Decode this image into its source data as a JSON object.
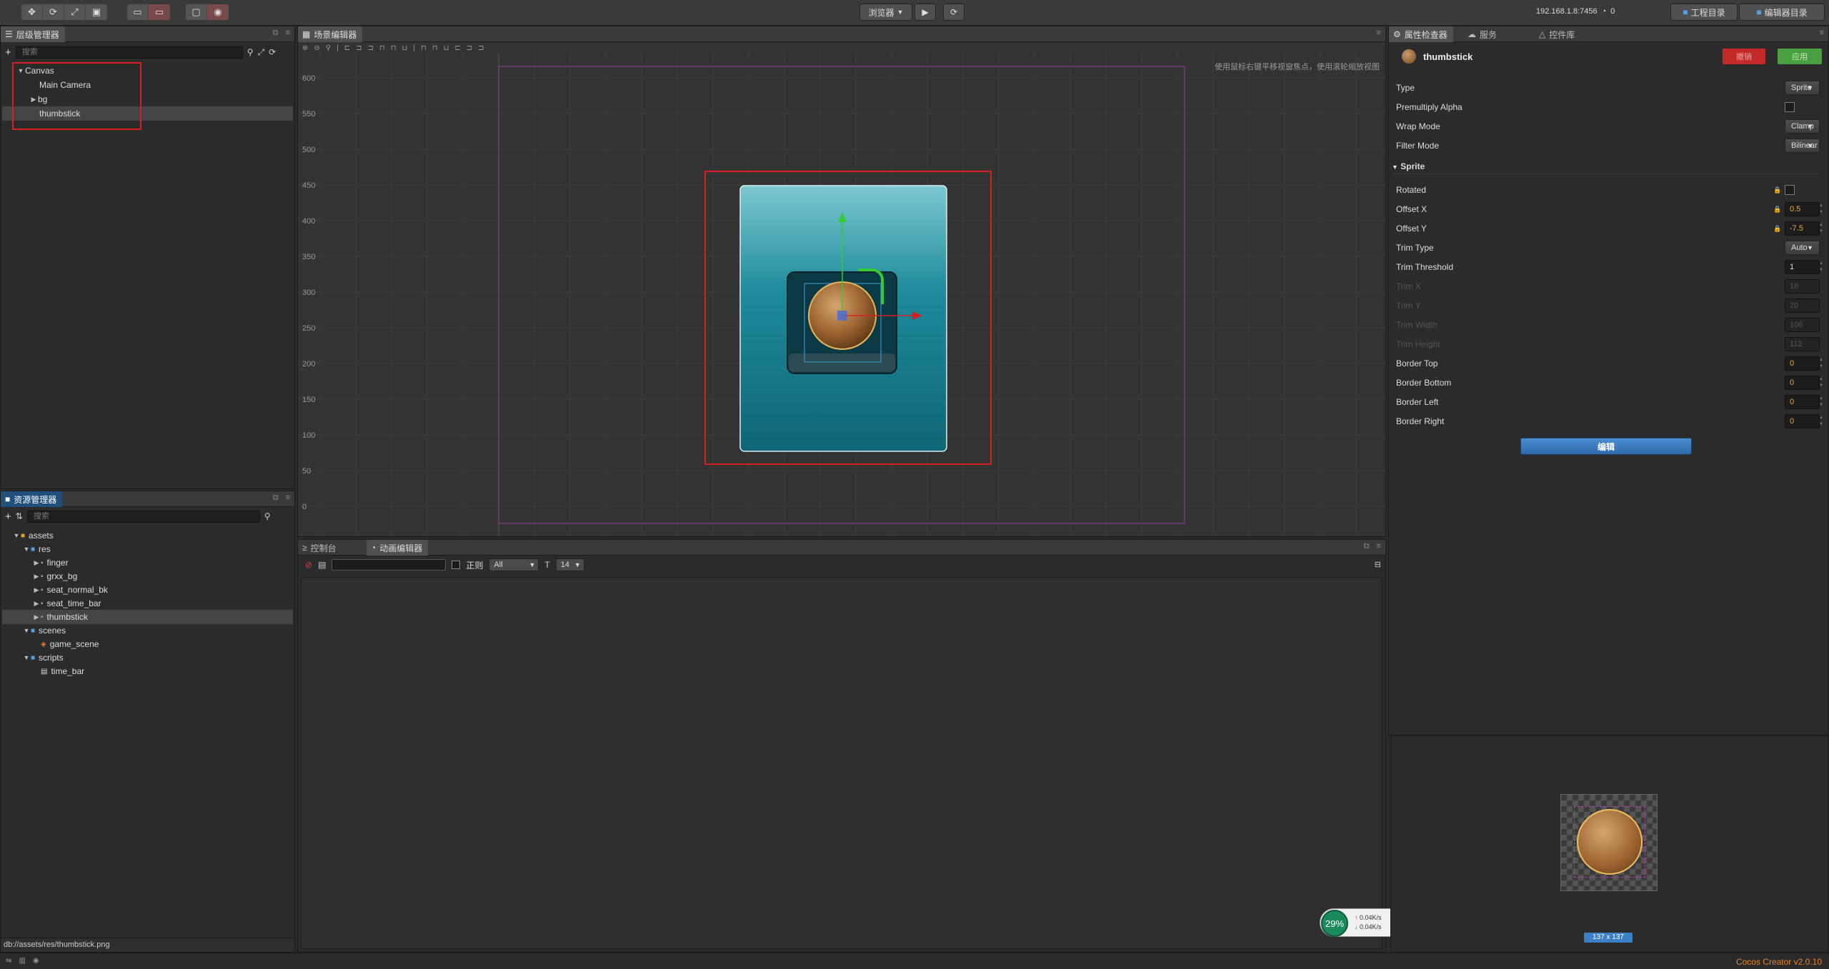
{
  "toolbar": {
    "preview_label": "浏览器",
    "ip_address": "192.168.1.8:7456",
    "wifi_count": "0",
    "project_dir": "工程目录",
    "editor_dir": "编辑器目录"
  },
  "hierarchy": {
    "title": "层级管理器",
    "search_placeholder": "搜索",
    "nodes": [
      {
        "label": "Canvas",
        "expanded": true
      },
      {
        "label": "Main Camera"
      },
      {
        "label": "bg",
        "collapsed": true
      },
      {
        "label": "thumbstick",
        "selected": true
      }
    ]
  },
  "scene": {
    "title": "场景编辑器",
    "hint": "使用鼠标右键平移视窗焦点，使用滚轮缩放视图",
    "y_ticks": [
      "600",
      "550",
      "500",
      "450",
      "400",
      "350",
      "300",
      "250",
      "200",
      "150",
      "100",
      "50",
      "0"
    ],
    "x_ticks": [
      "-300",
      "-250",
      "-200",
      "-150",
      "-100",
      "-50",
      "0",
      "50",
      "100",
      "150",
      "200",
      "250",
      "300",
      "350",
      "400",
      "450",
      "500",
      "550",
      "600",
      "650",
      "700",
      "750",
      "800",
      "850",
      "900",
      "950",
      "1,000",
      "1,050",
      "1,100",
      "1,150",
      "1,200"
    ]
  },
  "assets": {
    "title": "资源管理器",
    "search_placeholder": "搜索",
    "items": [
      {
        "label": "assets",
        "depth": 0,
        "icon": "assets-db-icon"
      },
      {
        "label": "res",
        "depth": 1,
        "icon": "folder-icon"
      },
      {
        "label": "finger",
        "depth": 2,
        "icon": "image-icon"
      },
      {
        "label": "grxx_bg",
        "depth": 2,
        "icon": "image-icon"
      },
      {
        "label": "seat_normal_bk",
        "depth": 2,
        "icon": "image-icon"
      },
      {
        "label": "seat_time_bar",
        "depth": 2,
        "icon": "image-icon"
      },
      {
        "label": "thumbstick",
        "depth": 2,
        "icon": "image-icon",
        "selected": true
      },
      {
        "label": "scenes",
        "depth": 1,
        "icon": "folder-icon"
      },
      {
        "label": "game_scene",
        "depth": 2,
        "icon": "scene-icon"
      },
      {
        "label": "scripts",
        "depth": 1,
        "icon": "folder-icon"
      },
      {
        "label": "time_bar",
        "depth": 2,
        "icon": "script-icon"
      }
    ],
    "footer_path": "db://assets/res/thumbstick.png"
  },
  "console": {
    "tab_console": "控制台",
    "tab_animation": "动画编辑器",
    "regex_label": "正则",
    "level_filter": "All",
    "font_size": "14"
  },
  "network": {
    "percent": "29%",
    "upload": "0.04K/s",
    "download": "0.04K/s"
  },
  "inspector": {
    "tabs": [
      "属性检查器",
      "服务",
      "控件库"
    ],
    "node_name": "thumbstick",
    "revert_label": "撤销",
    "apply_label": "应用",
    "type_label": "Type",
    "type_value": "Sprite",
    "premultiply_label": "Premultiply Alpha",
    "wrap_label": "Wrap Mode",
    "wrap_value": "Clamp",
    "filter_label": "Filter Mode",
    "filter_value": "Bilinear",
    "section_sprite": "Sprite",
    "rotated_label": "Rotated",
    "offset_x_label": "Offset X",
    "offset_x": "0.5",
    "offset_y_label": "Offset Y",
    "offset_y": "-7.5",
    "trim_type_label": "Trim Type",
    "trim_type": "Auto",
    "trim_threshold_label": "Trim Threshold",
    "trim_threshold": "1",
    "trim_x_label": "Trim X",
    "trim_x": "16",
    "trim_y_label": "Trim Y",
    "trim_y": "20",
    "trim_width_label": "Trim Width",
    "trim_width": "106",
    "trim_height_label": "Trim Height",
    "trim_height": "112",
    "border_top_label": "Border Top",
    "border_top": "0",
    "border_bottom_label": "Border Bottom",
    "border_bottom": "0",
    "border_left_label": "Border Left",
    "border_left": "0",
    "border_right_label": "Border Right",
    "border_right": "0",
    "edit_label": "编辑",
    "preview_size": "137 x 137"
  },
  "status": {
    "app_version": "Cocos Creator v2.0.10"
  },
  "colors": {
    "accent_red": "#d42020",
    "accent_blue": "#3b7fc4",
    "teal": "#1a7b8c"
  }
}
